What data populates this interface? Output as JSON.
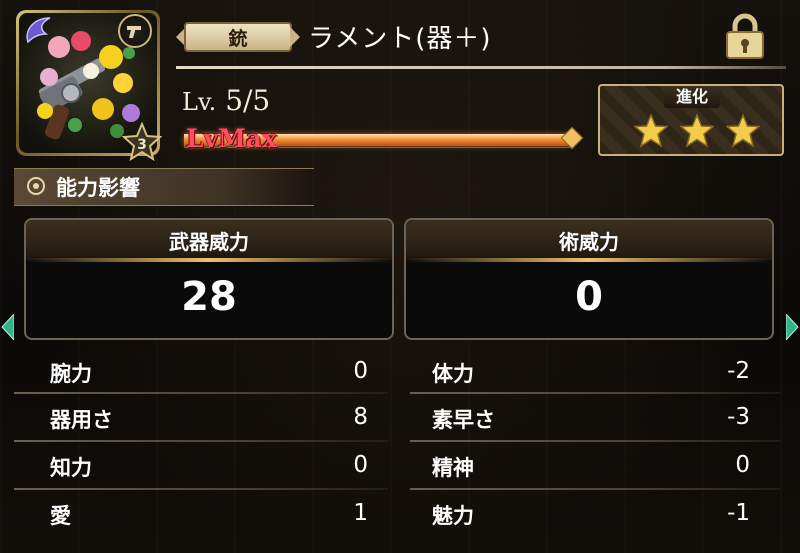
{
  "weapon": {
    "category": "銃",
    "name": "ラメント(器＋)",
    "rarity": "3",
    "level_label": "Lv.",
    "level_value": "5/5",
    "level_status": "LvMax",
    "level_progress_pct": 100,
    "locked": true
  },
  "evolution": {
    "label": "進化",
    "stars_filled": 3,
    "stars_total": 3
  },
  "section": {
    "title": "能力影響"
  },
  "power": {
    "weapon_power_label": "武器威力",
    "weapon_power_value": "28",
    "art_power_label": "術威力",
    "art_power_value": "0"
  },
  "attributes": {
    "left": [
      {
        "label": "腕力",
        "value": "0"
      },
      {
        "label": "器用さ",
        "value": "8"
      },
      {
        "label": "知力",
        "value": "0"
      },
      {
        "label": "愛",
        "value": "1"
      }
    ],
    "right": [
      {
        "label": "体力",
        "value": "-2"
      },
      {
        "label": "素早さ",
        "value": "-3"
      },
      {
        "label": "精神",
        "value": "0"
      },
      {
        "label": "魅力",
        "value": "-1"
      }
    ]
  },
  "colors": {
    "accent_gold": "#c7b07a",
    "lvmax_red": "#ff4d5d",
    "bar_orange": "#f08a2a"
  }
}
